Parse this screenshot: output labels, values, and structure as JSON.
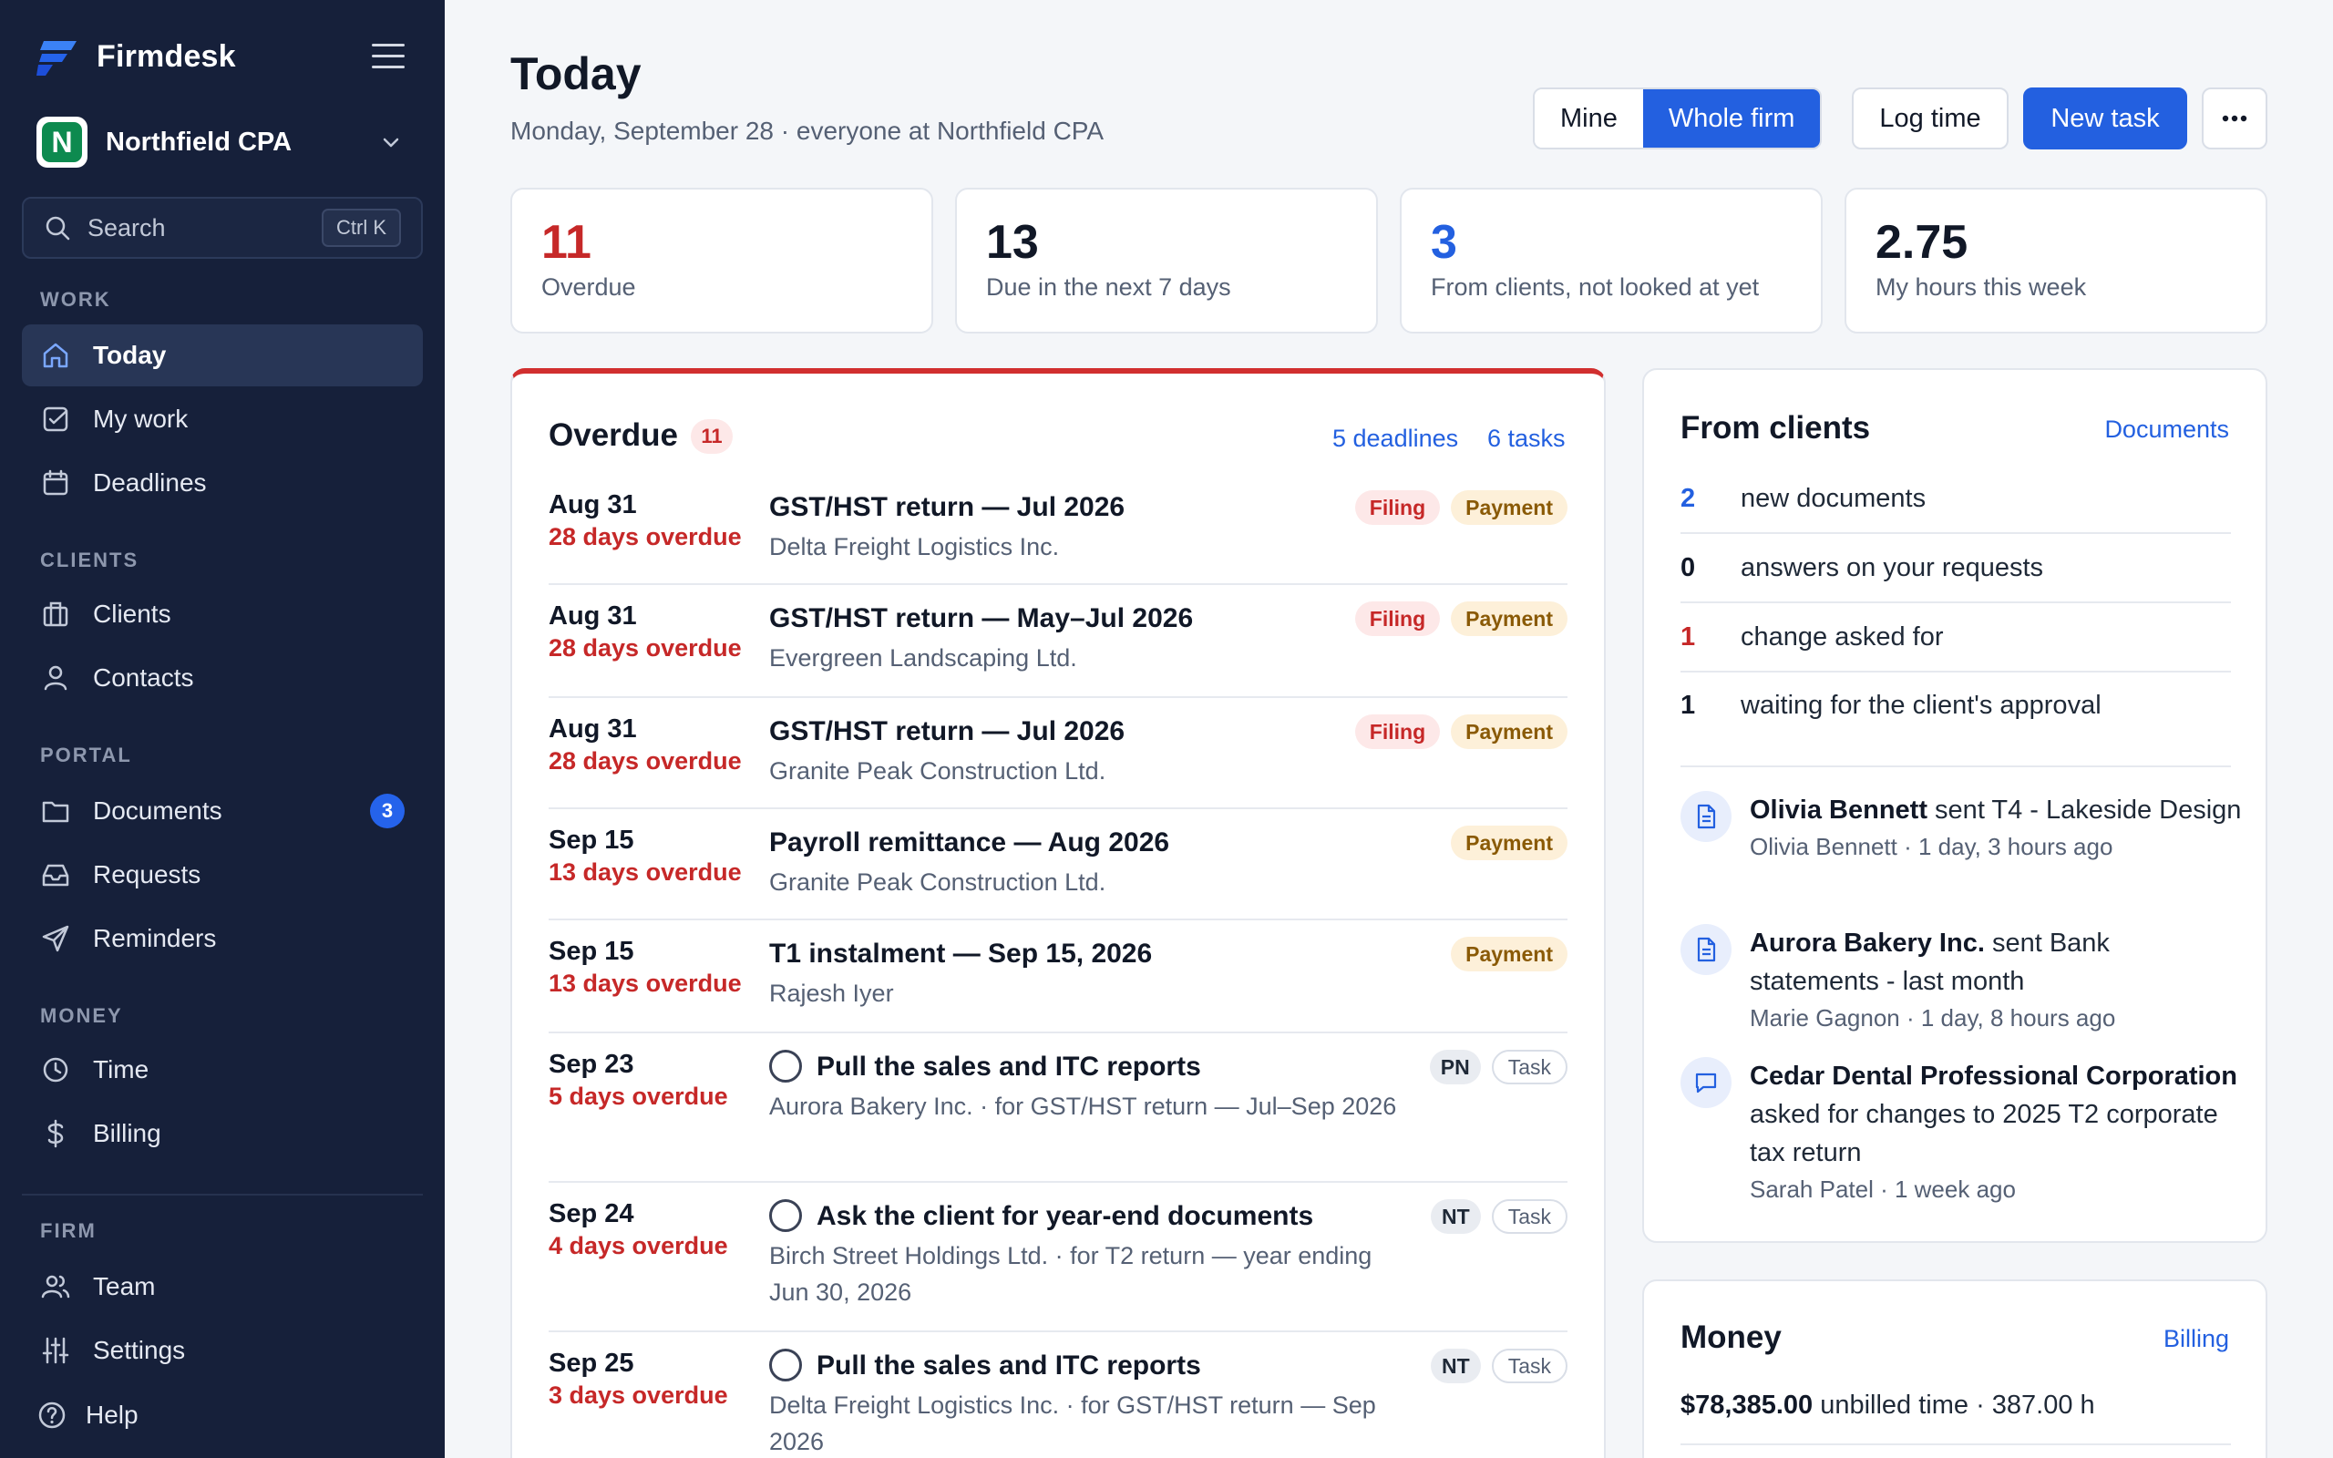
{
  "app": {
    "name": "Firmdesk"
  },
  "org": {
    "name": "Northfield CPA",
    "initial": "N"
  },
  "search": {
    "label": "Search",
    "shortcut": "Ctrl K"
  },
  "nav": {
    "work_label": "WORK",
    "today": "Today",
    "my_work": "My work",
    "deadlines": "Deadlines",
    "clients_label": "CLIENTS",
    "clients": "Clients",
    "contacts": "Contacts",
    "portal_label": "PORTAL",
    "documents": "Documents",
    "documents_badge": "3",
    "requests": "Requests",
    "reminders": "Reminders",
    "money_label": "MONEY",
    "time": "Time",
    "billing": "Billing",
    "firm_label": "FIRM",
    "team": "Team",
    "settings": "Settings",
    "help": "Help"
  },
  "header": {
    "title": "Today",
    "subtitle": "Monday, September 28 · everyone at Northfield CPA",
    "mine": "Mine",
    "whole_firm": "Whole firm",
    "log_time": "Log time",
    "new_task": "New task",
    "more": "···"
  },
  "stats": [
    {
      "value": "11",
      "label": "Overdue"
    },
    {
      "value": "13",
      "label": "Due in the next 7 days"
    },
    {
      "value": "3",
      "label": "From clients, not looked at yet"
    },
    {
      "value": "2.75",
      "label": "My hours this week"
    }
  ],
  "overdue": {
    "title": "Overdue",
    "count": "11",
    "deadlines_link": "5 deadlines",
    "tasks_link": "6 tasks",
    "rows": [
      {
        "date": "Aug 31",
        "overdue": "28 days overdue",
        "title": "GST/HST return — Jul 2026",
        "sub": "Delta Freight Logistics Inc.",
        "tag1": "Filing",
        "tag2": "Payment"
      },
      {
        "date": "Aug 31",
        "overdue": "28 days overdue",
        "title": "GST/HST return — May–Jul 2026",
        "sub": "Evergreen Landscaping Ltd.",
        "tag1": "Filing",
        "tag2": "Payment"
      },
      {
        "date": "Aug 31",
        "overdue": "28 days overdue",
        "title": "GST/HST return — Jul 2026",
        "sub": "Granite Peak Construction Ltd.",
        "tag1": "Filing",
        "tag2": "Payment"
      },
      {
        "date": "Sep 15",
        "overdue": "13 days overdue",
        "title": "Payroll remittance — Aug 2026",
        "sub": "Granite Peak Construction Ltd.",
        "tag2": "Payment"
      },
      {
        "date": "Sep 15",
        "overdue": "13 days overdue",
        "title": "T1 instalment — Sep 15, 2026",
        "sub": "Rajesh Iyer",
        "tag2": "Payment"
      },
      {
        "date": "Sep 23",
        "overdue": "5 days overdue",
        "title": "Pull the sales and ITC reports",
        "sub": "Aurora Bakery Inc. · for GST/HST return — Jul–Sep 2026",
        "initials": "PN",
        "tag_task": "Task"
      },
      {
        "date": "Sep 24",
        "overdue": "4 days overdue",
        "title": "Ask the client for year-end documents",
        "sub": "Birch Street Holdings Ltd. · for T2 return — year ending Jun 30, 2026",
        "initials": "NT",
        "tag_task": "Task"
      },
      {
        "date": "Sep 25",
        "overdue": "3 days overdue",
        "title": "Pull the sales and ITC reports",
        "sub": "Delta Freight Logistics Inc. · for GST/HST return — Sep 2026",
        "initials": "NT",
        "tag_task": "Task"
      }
    ]
  },
  "from_clients": {
    "title": "From clients",
    "link": "Documents",
    "counts": [
      {
        "num": "2",
        "text": "new documents"
      },
      {
        "num": "0",
        "text": "answers on your requests"
      },
      {
        "num": "1",
        "text": "change asked for"
      },
      {
        "num": "1",
        "text": "waiting for the client's approval"
      }
    ],
    "activity": [
      {
        "who": "Olivia Bennett",
        "what": " sent T4 - Lakeside Design",
        "meta": "Olivia Bennett · 1 day, 3 hours ago"
      },
      {
        "who": "Aurora Bakery Inc.",
        "what": " sent Bank statements - last month",
        "meta": "Marie Gagnon · 1 day, 8 hours ago"
      },
      {
        "who": "Cedar Dental Professional Corporation",
        "what": " asked for changes to 2025 T2 corporate tax return",
        "meta": "Sarah Patel · 1 week ago"
      }
    ]
  },
  "money": {
    "title": "Money",
    "link": "Billing",
    "amount": "$78,385.00",
    "detail": " unbilled time · 387.00 h"
  },
  "colors": {
    "sidebar": "#16203a",
    "accent": "#2360e0",
    "danger": "#c62828",
    "blue_stat": "#2360e0"
  }
}
